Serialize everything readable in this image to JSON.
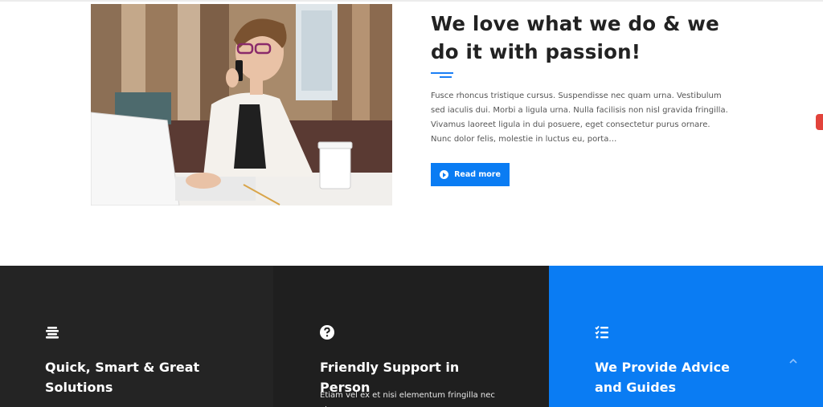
{
  "intro": {
    "title": "We love what we do & we do it with passion!",
    "body": "Fusce rhoncus tristique cursus. Suspendisse nec quam urna. Vestibulum sed iaculis dui. Morbi a ligula urna. Nulla facilisis non nisl gravida fringilla. Vivamus laoreet ligula in dui posuere, eget consectetur purus ornare. Nunc dolor felis, molestie in luctus eu, porta…",
    "button_label": "Read more",
    "button_icon": "arrow-circle-right-icon"
  },
  "features": [
    {
      "icon": "align-center-icon",
      "title": "Quick, Smart & Great Solutions",
      "text": ""
    },
    {
      "icon": "question-circle-icon",
      "title": "Friendly Support in Person",
      "text": "Etiam vel ex et nisi elementum fringilla nec at"
    },
    {
      "icon": "tasks-list-icon",
      "title": "We Provide Advice and Guides",
      "text": ""
    }
  ],
  "colors": {
    "accent": "#0a7cf3",
    "dark_panel_1": "#242424",
    "dark_panel_2": "#1f1f1f",
    "heading": "#222222",
    "side_tab": "#e2433b"
  }
}
